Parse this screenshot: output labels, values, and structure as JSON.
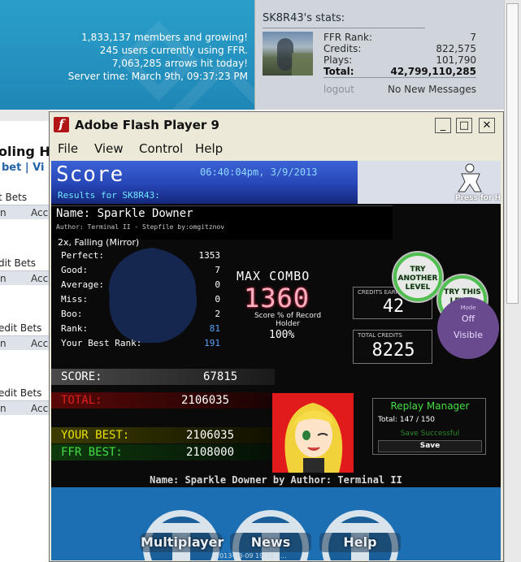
{
  "site": {
    "stats_lines": [
      "1,833,137 members and growing!",
      "245 users currently using FFR.",
      "7,063,285 arrows hit today!",
      "Server time: March 9th, 09:37:23 PM"
    ]
  },
  "user_stats": {
    "title": "SK8R43's stats:",
    "rows": [
      {
        "label": "FFR Rank:",
        "value": "7"
      },
      {
        "label": "Credits:",
        "value": "822,575"
      },
      {
        "label": "Plays:",
        "value": "101,790"
      },
      {
        "label": "Total:",
        "value": "42,799,110,285"
      }
    ],
    "logout": "logout",
    "messages": "No New Messages"
  },
  "left_page": {
    "title": "oling Ha",
    "links": "bet  |  Vi",
    "groups": [
      {
        "label": "t Bets",
        "col1": "n",
        "col2": "Acc"
      },
      {
        "label": "dit Bets",
        "col1": "n",
        "col2": "Acc"
      },
      {
        "label": "edit Bets",
        "col1": "n",
        "col2": "Acc"
      },
      {
        "label": "edit Bets",
        "col1": "n",
        "col2": "Acc"
      }
    ]
  },
  "window": {
    "title": "Adobe Flash Player 9",
    "logo": "f",
    "minimize": "_",
    "maximize": "□",
    "close": "✕",
    "menu": [
      "File",
      "View",
      "Control",
      "Help"
    ]
  },
  "results": {
    "title": "Score",
    "datetime": "06:40:04pm, 3/9/2013",
    "results_for": "Results for SK8R43:",
    "hiscore_label": "Press for Hi-Scores",
    "song_name": "Name: Sparkle Downer",
    "song_author": "Author: Terminal II - Stepfile by:omgitznov",
    "mods": "2x, Falling (Mirror)",
    "judges": [
      {
        "label": "Perfect:",
        "value": "1353"
      },
      {
        "label": "Good:",
        "value": "7"
      },
      {
        "label": "Average:",
        "value": "0"
      },
      {
        "label": "Miss:",
        "value": "0"
      },
      {
        "label": "Boo:",
        "value": "2"
      },
      {
        "label": "Rank:",
        "value": "81"
      },
      {
        "label": "Your Best Rank:",
        "value": "191"
      }
    ],
    "max_combo_label": "MAX COMBO",
    "max_combo": "1360",
    "record_holder_label": "Score % of Record Holder",
    "record_holder_pct": "100%",
    "credits_earned_label": "CREDITS EARNED",
    "credits_earned": "42",
    "total_credits_label": "TOTAL CREDITS",
    "total_credits": "8225",
    "try_another": "TRY ANOTHER LEVEL",
    "try_again": "TRY THIS LEVEL AGAIN",
    "mode_label": "Mode",
    "mode_off": "Off",
    "mode_visible": "Visible",
    "score_label": "SCORE:",
    "score": "67815",
    "total_label": "TOTAL:",
    "total": "2106035",
    "your_best_label": "YOUR BEST:",
    "your_best": "2106035",
    "ffr_best_label": "FFR BEST:",
    "ffr_best": "2108000",
    "replay_title": "Replay Manager",
    "replay_total": "Total: 147 / 150",
    "replay_status": "Save Successful",
    "replay_save": "Save",
    "footer": "Name: Sparkle Downer by Author: Terminal II",
    "nav": [
      "Multiplayer",
      "News",
      "Help"
    ],
    "timestamp": "2013-03-09 19:39:1..."
  },
  "colors": {
    "banner_blue": "#2491bf",
    "header_blue": "#2746b6",
    "accent_green": "#44dd44",
    "score_red": "#e02020",
    "best_yellow": "#e8e000",
    "combo_pink": "#ffb0c0",
    "mode_purple": "#6a4a8f"
  }
}
